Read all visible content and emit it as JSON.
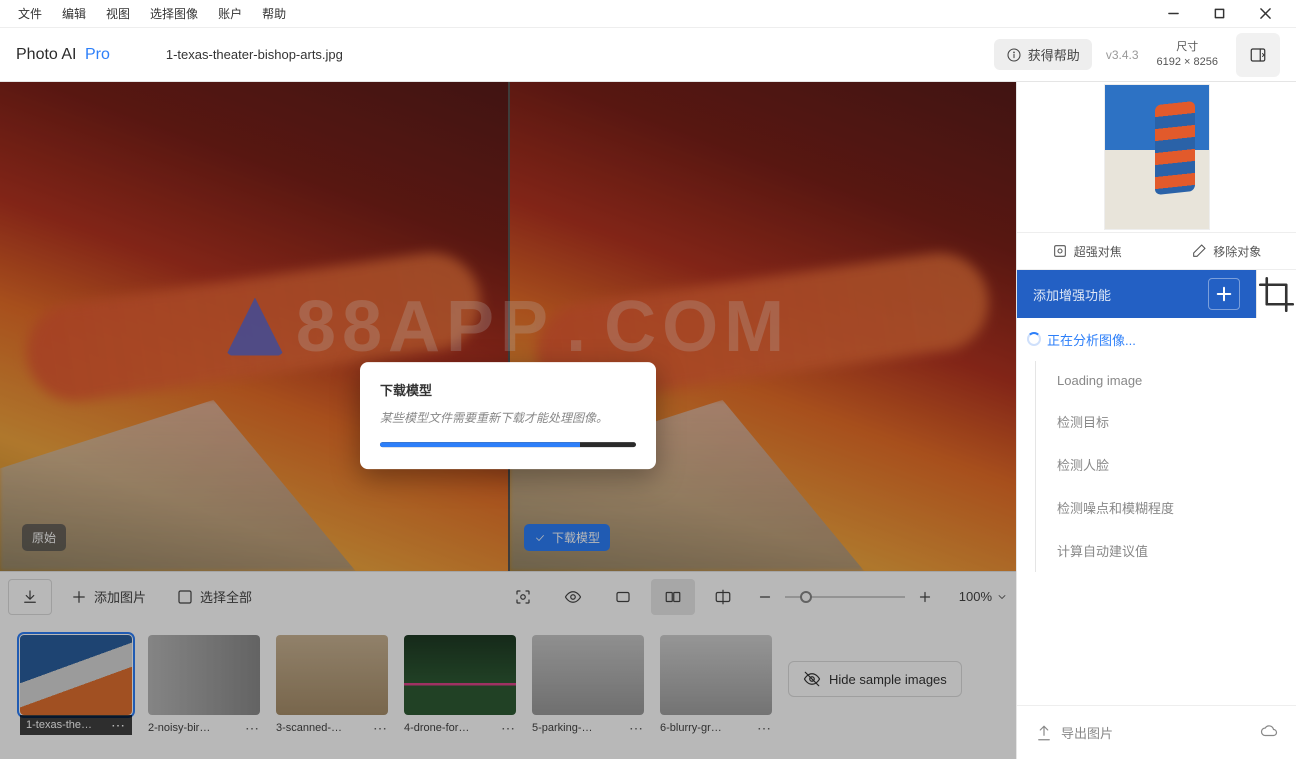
{
  "menu": {
    "items": [
      "文件",
      "编辑",
      "视图",
      "选择图像",
      "账户",
      "帮助"
    ]
  },
  "brand": {
    "name": "Photo AI",
    "tier": "Pro"
  },
  "filename": "1-texas-theater-bishop-arts.jpg",
  "help_button": "获得帮助",
  "version": "v3.4.3",
  "dimensions": {
    "label": "尺寸",
    "value": "6192 × 8256"
  },
  "viewer": {
    "original_badge": "原始",
    "download_badge": "下载模型",
    "watermark": "88APP . COM"
  },
  "modal": {
    "title": "下载模型",
    "message": "某些模型文件需要重新下载才能处理图像。",
    "progress_pct": 78
  },
  "toolbar": {
    "add_images": "添加图片",
    "select_all": "选择全部",
    "zoom_value": "100%"
  },
  "thumbnails": [
    {
      "label": "1-texas-the…",
      "cls": "th1",
      "selected": true
    },
    {
      "label": "2-noisy-bir…",
      "cls": "th2",
      "selected": false
    },
    {
      "label": "3-scanned-…",
      "cls": "th3",
      "selected": false
    },
    {
      "label": "4-drone-for…",
      "cls": "th4",
      "selected": false
    },
    {
      "label": "5-parking-…",
      "cls": "th5",
      "selected": false
    },
    {
      "label": "6-blurry-gr…",
      "cls": "th6",
      "selected": false
    }
  ],
  "hide_samples": "Hide sample images",
  "right_panel": {
    "super_focus": "超强对焦",
    "remove_object": "移除对象",
    "add_enhancement": "添加增强功能",
    "analyzing": "正在分析图像...",
    "steps": {
      "loading": "Loading image",
      "detect_target": "检测目标",
      "detect_face": "检测人脸",
      "detect_noise": "检测噪点和模糊程度",
      "compute_suggest": "计算自动建议值"
    },
    "export": "导出图片"
  }
}
